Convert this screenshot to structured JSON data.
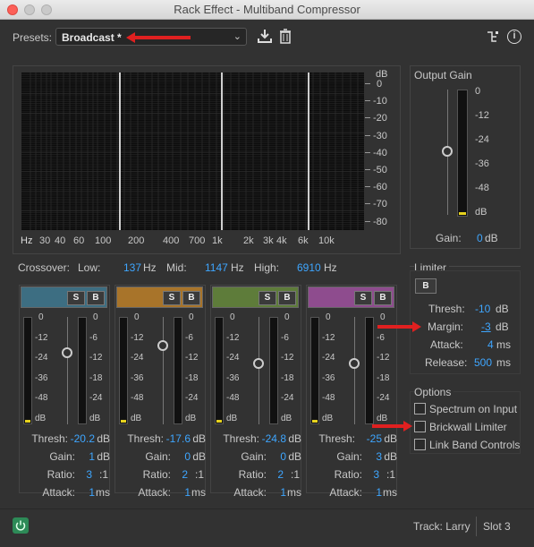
{
  "window": {
    "title": "Rack Effect - Multiband Compressor"
  },
  "presets": {
    "label": "Presets:",
    "value": "Broadcast *"
  },
  "graph": {
    "db_label": "dB",
    "db_ticks": [
      "0",
      "-10",
      "-20",
      "-30",
      "-40",
      "-50",
      "-60",
      "-70",
      "-80"
    ],
    "freq_ticks": [
      "Hz",
      "30",
      "40",
      "60",
      "100",
      "200",
      "400",
      "700",
      "1k",
      "2k",
      "3k",
      "4k",
      "6k",
      "10k"
    ]
  },
  "output_gain": {
    "title": "Output Gain",
    "ticks": [
      "0",
      "-12",
      "-24",
      "-36",
      "-48",
      "dB"
    ],
    "gain_label": "Gain:",
    "gain_value": "0",
    "gain_unit": "dB"
  },
  "crossover": {
    "label": "Crossover:",
    "low_label": "Low:",
    "low_value": "137",
    "mid_label": "Mid:",
    "mid_value": "1147",
    "high_label": "High:",
    "high_value": "6910",
    "unit": "Hz"
  },
  "band_meter_ticks_left": [
    "0",
    "-12",
    "-24",
    "-36",
    "-48",
    "dB"
  ],
  "band_meter_ticks_right": [
    "0",
    "-6",
    "-12",
    "-18",
    "-24",
    "dB"
  ],
  "bands": [
    {
      "color": "#3d6e82",
      "solo": "S",
      "bypass": "B",
      "thresh": "-20.2",
      "gain": "1",
      "ratio": "3",
      "attack": "1"
    },
    {
      "color": "#a8742a",
      "solo": "S",
      "bypass": "B",
      "thresh": "-17.6",
      "gain": "0",
      "ratio": "2",
      "attack": "1"
    },
    {
      "color": "#5e7c3a",
      "solo": "S",
      "bypass": "B",
      "thresh": "-24.8",
      "gain": "0",
      "ratio": "2",
      "attack": "1"
    },
    {
      "color": "#8e4c8e",
      "solo": "S",
      "bypass": "B",
      "thresh": "-25",
      "gain": "3",
      "ratio": "3",
      "attack": "1"
    }
  ],
  "band_labels": {
    "thresh": "Thresh:",
    "gain": "Gain:",
    "ratio": "Ratio:",
    "attack": "Attack:",
    "db": "dB",
    "ratio_unit": ":1",
    "ms": "ms"
  },
  "limiter": {
    "title": "Limiter",
    "bypass": "B",
    "thresh_label": "Thresh:",
    "thresh_value": "-10",
    "margin_label": "Margin:",
    "margin_value": "-3",
    "attack_label": "Attack:",
    "attack_value": "4",
    "release_label": "Release:",
    "release_value": "500",
    "db": "dB",
    "ms": "ms"
  },
  "options": {
    "title": "Options",
    "spectrum": "Spectrum on Input",
    "brickwall": "Brickwall Limiter",
    "link": "Link Band Controls"
  },
  "footer": {
    "track": "Track: Larry",
    "slot": "Slot 3"
  },
  "colors": {
    "accent": "#3ea6ff",
    "annotation_arrow": "#e02020"
  }
}
